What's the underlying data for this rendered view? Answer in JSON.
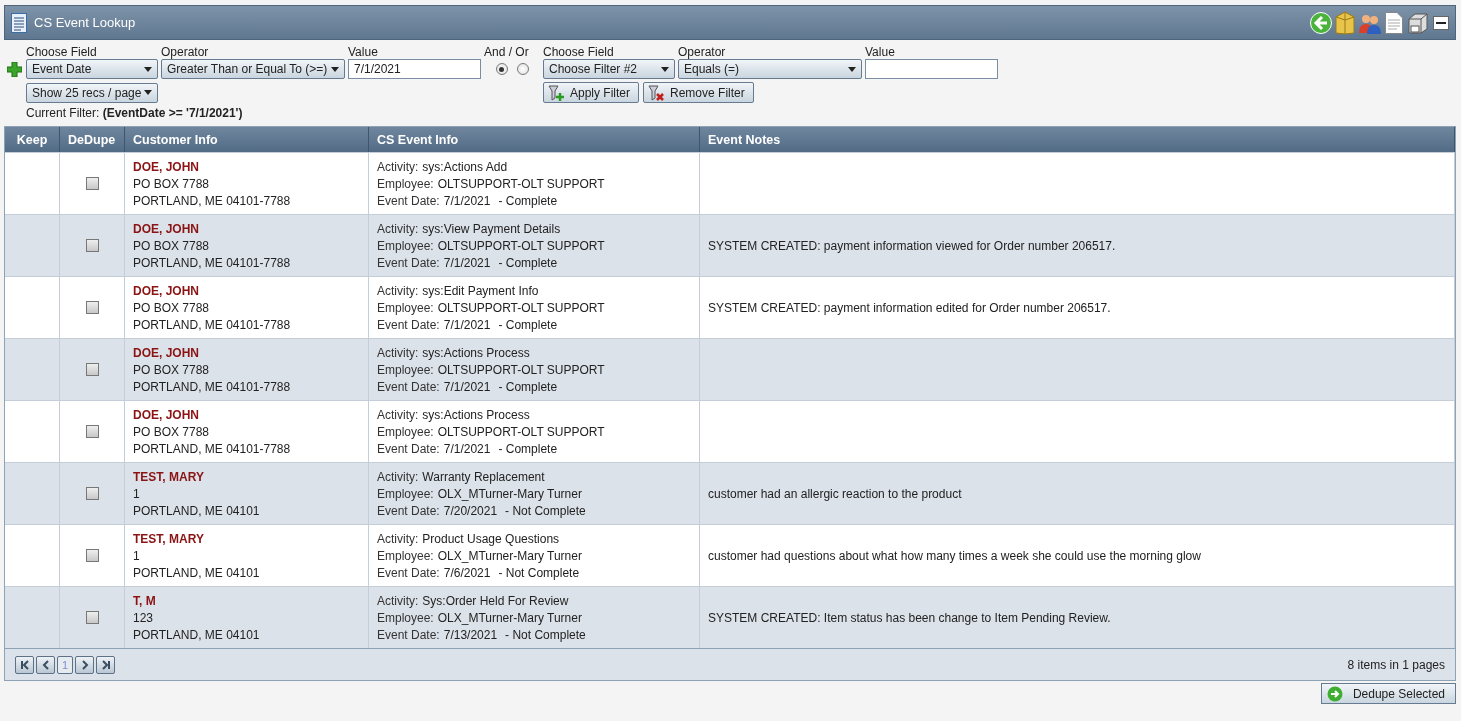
{
  "window": {
    "title": "CS Event Lookup"
  },
  "filter": {
    "field_1": {
      "label": "Choose Field",
      "value": "Event Date"
    },
    "operator_1": {
      "label": "Operator",
      "value": "Greater Than or Equal To (>=)"
    },
    "value_1": {
      "label": "Value",
      "value": "7/1/2021"
    },
    "and_or": {
      "label": "And / Or",
      "options": [
        {
          "selected": true
        },
        {
          "selected": false
        }
      ]
    },
    "field_2": {
      "label": "Choose Field",
      "value": "Choose Filter #2"
    },
    "operator_2": {
      "label": "Operator",
      "value": "Equals (=)"
    },
    "value_2": {
      "label": "Value"
    },
    "page_size": "Show 25 recs / page",
    "apply_button": "Apply Filter",
    "remove_button": "Remove Filter",
    "current_filter": {
      "label": "Current Filter:",
      "value": "(EventDate >= '7/1/2021')"
    }
  },
  "table": {
    "columns": [
      "Keep",
      "DeDupe",
      "Customer Info",
      "CS Event Info",
      "Event Notes"
    ],
    "rows": [
      {
        "checked": false,
        "name": "DOE, JOHN",
        "address_1": "PO BOX 7788",
        "address_2": "PORTLAND, ME 04101-7788",
        "activity": [
          "Activity:",
          "sys:Actions Add"
        ],
        "employee": [
          "Employee:",
          "OLTSUPPORT-OLT SUPPORT"
        ],
        "event_date": [
          "Event Date:",
          "7/1/2021",
          "- Complete"
        ]
      },
      {
        "checked": false,
        "name": "DOE, JOHN",
        "address_1": "PO BOX 7788",
        "address_2": "PORTLAND, ME 04101-7788",
        "activity": [
          "Activity:",
          "sys:View Payment Details"
        ],
        "employee": [
          "Employee:",
          "OLTSUPPORT-OLT SUPPORT"
        ],
        "event_date": [
          "Event Date:",
          "7/1/2021",
          "- Complete"
        ],
        "notes": "SYSTEM CREATED: payment information viewed for Order number 206517."
      },
      {
        "checked": false,
        "name": "DOE, JOHN",
        "address_1": "PO BOX 7788",
        "address_2": "PORTLAND, ME 04101-7788",
        "activity": [
          "Activity:",
          "sys:Edit Payment Info"
        ],
        "employee": [
          "Employee:",
          "OLTSUPPORT-OLT SUPPORT"
        ],
        "event_date": [
          "Event Date:",
          "7/1/2021",
          "- Complete"
        ],
        "notes": "SYSTEM CREATED: payment information edited for Order number 206517."
      },
      {
        "checked": false,
        "name": "DOE, JOHN",
        "address_1": "PO BOX 7788",
        "address_2": "PORTLAND, ME 04101-7788",
        "activity": [
          "Activity:",
          "sys:Actions Process"
        ],
        "employee": [
          "Employee:",
          "OLTSUPPORT-OLT SUPPORT"
        ],
        "event_date": [
          "Event Date:",
          "7/1/2021",
          "- Complete"
        ]
      },
      {
        "checked": false,
        "name": "DOE, JOHN",
        "address_1": "PO BOX 7788",
        "address_2": "PORTLAND, ME 04101-7788",
        "activity": [
          "Activity:",
          "sys:Actions Process"
        ],
        "employee": [
          "Employee:",
          "OLTSUPPORT-OLT SUPPORT"
        ],
        "event_date": [
          "Event Date:",
          "7/1/2021",
          "- Complete"
        ]
      },
      {
        "checked": false,
        "name": "TEST, MARY",
        "address_1": "1",
        "address_2": "PORTLAND, ME 04101",
        "activity": [
          "Activity:",
          "Warranty Replacement"
        ],
        "employee": [
          "Employee:",
          "OLX_MTurner-Mary Turner"
        ],
        "event_date": [
          "Event Date:",
          "7/20/2021",
          "- Not Complete"
        ],
        "notes": "customer had an allergic reaction to the product"
      },
      {
        "checked": false,
        "name": "TEST, MARY",
        "address_1": "1",
        "address_2": "PORTLAND, ME 04101",
        "activity": [
          "Activity:",
          "Product Usage Questions"
        ],
        "employee": [
          "Employee:",
          "OLX_MTurner-Mary Turner"
        ],
        "event_date": [
          "Event Date:",
          "7/6/2021",
          "- Not Complete"
        ],
        "notes": "customer had questions about what how many times a week she could use the morning glow"
      },
      {
        "checked": false,
        "name": "T, M",
        "address_1": "123",
        "address_2": "PORTLAND, ME 04101",
        "activity": [
          "Activity:",
          "Sys:Order Held For Review"
        ],
        "employee": [
          "Employee:",
          "OLX_MTurner-Mary Turner"
        ],
        "event_date": [
          "Event Date:",
          "7/13/2021",
          "- Not Complete"
        ],
        "notes": "SYSTEM CREATED: Item status has been change to Item Pending Review."
      }
    ]
  },
  "pager": {
    "page": "1",
    "summary": "8 items in 1 pages"
  },
  "dedupe_button": "Dedupe Selected"
}
